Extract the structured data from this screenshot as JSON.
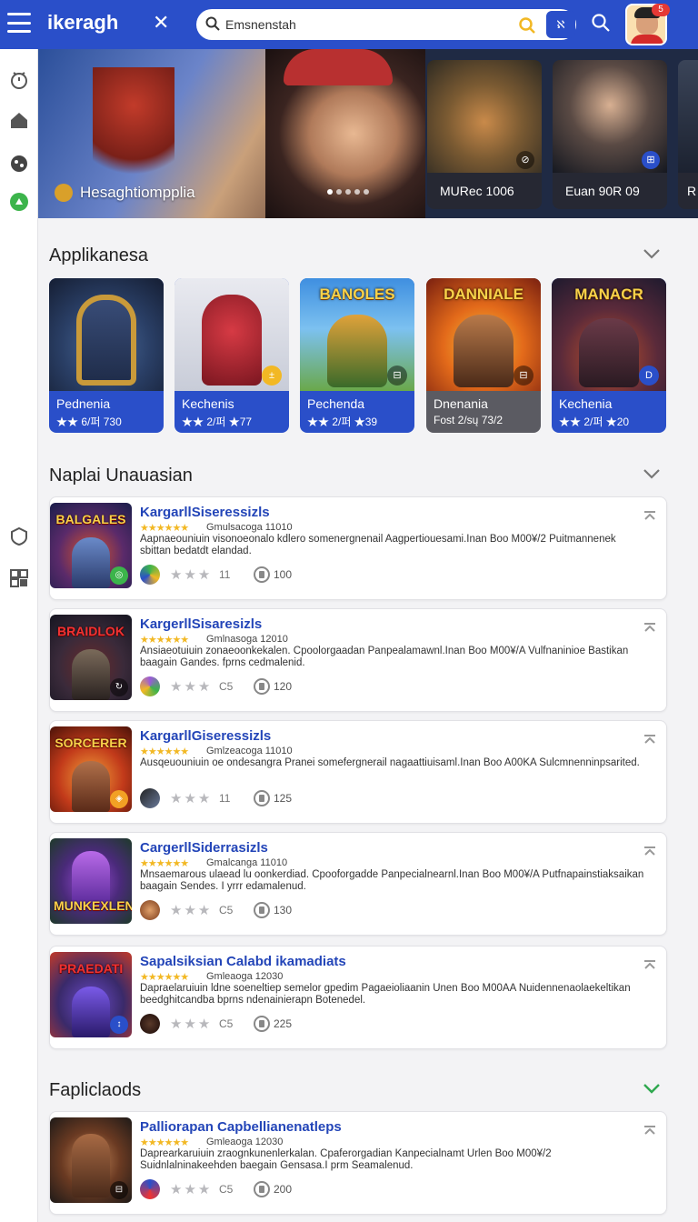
{
  "header": {
    "brand": "ikeragh",
    "search_value": "Emsnenstah",
    "search_button_label": "ℵ",
    "notification_count": "5"
  },
  "hero": {
    "caption": "Hesaghtiompplia",
    "cards": [
      {
        "label": "MURec 1006"
      },
      {
        "label": "Euan 90R 09"
      },
      {
        "label": "R"
      }
    ]
  },
  "section_apps": {
    "title": "Applikanesa",
    "tiles": [
      {
        "logo": "",
        "name": "Pednenia",
        "meta": "★★ 6/퍼 730",
        "chip": ""
      },
      {
        "logo": "",
        "name": "Kechenis",
        "meta": "★★ 2/퍼 ★77",
        "chip": "±"
      },
      {
        "logo": "BANOLES",
        "name": "Pechenda",
        "meta": "★★ 2/퍼 ★39",
        "chip": "⊟"
      },
      {
        "logo": "DANNIALE",
        "name": "Dnenania",
        "meta": "Fost 2/sų 73/2",
        "chip": "⊟"
      },
      {
        "logo": "MANACR",
        "name": "Kechenia",
        "meta": "★★ 2/퍼 ★20",
        "chip": "D"
      }
    ]
  },
  "section_list": {
    "title": "Naplai Unauasian",
    "items": [
      {
        "logo": "BALGALES",
        "title": "KargarllSiseressizls",
        "stars": "★★★★★★",
        "sub": "Gmulsacoga 11010",
        "desc": "Aapnaeouniuin visonoeonalo kdlero somenergnenail Aagpertiouesami.Inan Boo M00¥/2 Puitmannenek sbittan bedatdt elandad.",
        "rating": "11",
        "downloads": "100"
      },
      {
        "logo": "BRAIDLOK",
        "title": "KargerllSisaresizls",
        "stars": "★★★★★★",
        "sub": "Gmlnasoga 12010",
        "desc": "Ansiaeotuiuin zonaeoonkekalen. Cpoolorgaadan Panpealamawnl.Inan Boo M00¥/A Vulfnaninioe Bastikan baagain Gandes. fprns cedmalenid.",
        "rating": "C5",
        "downloads": "120"
      },
      {
        "logo": "SORCERER",
        "title": "KargarllGiseressizls",
        "stars": "★★★★★★",
        "sub": "Gmlzeacoga 11010",
        "desc": "Ausqeuouniuin oe ondesangra Pranei somefergnerail nagaattiuisaml.Inan Boo A00KA Sulcmnenninpsarited.",
        "rating": "11",
        "downloads": "125"
      },
      {
        "logo": "MUNKEXLEN",
        "title": "CargerllSiderrasizls",
        "stars": "★★★★★★",
        "sub": "Gmalcanga 11010",
        "desc": "Mnsaemarous ulaead lu oonkerdiad. Cpooforgadde Panpecialnearnl.Inan Boo M00¥/A Putfnapainstiaksaikan baagain Sendes. I yrrr edamalenud.",
        "rating": "C5",
        "downloads": "130"
      },
      {
        "logo": "PRAEDATI",
        "title": "Sapalsiksian Calabd ikamadiats",
        "stars": "★★★★★★",
        "sub": "Gmleaoga 12030",
        "desc": "Dapraelaruiuin ldne soeneltiep semelor gpedim Pagaeioliaanin Unen Boo M00AA Nuidennenaolaekeltikan beedghitcandba bprns ndenainierapn Botenedel.",
        "rating": "C5",
        "downloads": "225"
      }
    ]
  },
  "section_fav": {
    "title": "Fapliclaods",
    "items": [
      {
        "logo": "",
        "title": "Palliorapan Capbellianenatleps",
        "stars": "★★★★★★",
        "sub": "Gmleaoga 12030",
        "desc": "Daprearkaruiuin zraognkunenlerkalan. Cpaferorgadian Kanpecialnamt Urlen Boo M00¥/2 Suidnlalninakeehden baegain Gensasa.I prm Seamalenud.",
        "rating": "C5",
        "downloads": "200"
      }
    ]
  },
  "colors": {
    "primary": "#2a4fc9",
    "star": "#f2b824",
    "link_title": "#2345b8",
    "success_chevron": "#2fa84f"
  }
}
